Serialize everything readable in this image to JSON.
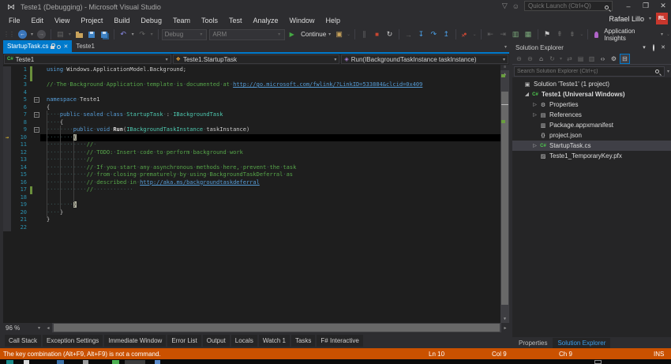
{
  "window": {
    "title": "Teste1 (Debugging) - Microsoft Visual Studio",
    "quick_launch_placeholder": "Quick Launch (Ctrl+Q)",
    "user_name": "Rafael Lillo",
    "avatar_initials": "RL"
  },
  "menu": {
    "items": [
      "File",
      "Edit",
      "View",
      "Project",
      "Build",
      "Debug",
      "Team",
      "Tools",
      "Test",
      "Analyze",
      "Window",
      "Help"
    ]
  },
  "toolbar": {
    "solution_config": "Debug",
    "solution_platform": "ARM",
    "continue_label": "Continue",
    "app_insights_label": "Application Insights"
  },
  "document_tabs": [
    {
      "label": "StartupTask.cs",
      "active": true,
      "locked": true,
      "pinned": false,
      "closable": true
    },
    {
      "label": "Teste1",
      "active": false
    }
  ],
  "navbar": {
    "project": "Teste1",
    "type": "Teste1.StartupTask",
    "member": "Run(IBackgroundTaskInstance taskInstance)"
  },
  "editor": {
    "zoom_level": "96 %",
    "lines": [
      {
        "t": [
          [
            "k",
            "using"
          ],
          [
            "p",
            " Windows.ApplicationModel.Background;"
          ]
        ],
        "chg": true
      },
      {
        "t": [],
        "chg": true
      },
      {
        "t": [
          [
            "c",
            "// The Background Application template is documented at "
          ],
          [
            "l",
            "http://go.microsoft.com/fwlink/?LinkID=533884&clcid=0x409"
          ]
        ]
      },
      {
        "t": []
      },
      {
        "t": [
          [
            "k",
            "namespace"
          ],
          [
            "p",
            " Teste1"
          ]
        ],
        "fold": true
      },
      {
        "t": [
          [
            "p",
            "{"
          ]
        ]
      },
      {
        "t": [
          [
            "p",
            "    "
          ],
          [
            "k",
            "public"
          ],
          [
            "p",
            " "
          ],
          [
            "k",
            "sealed"
          ],
          [
            "p",
            " "
          ],
          [
            "k",
            "class"
          ],
          [
            "p",
            " "
          ],
          [
            "t2",
            "StartupTask"
          ],
          [
            "p",
            " : "
          ],
          [
            "t2",
            "IBackgroundTask"
          ]
        ],
        "fold": true
      },
      {
        "t": [
          [
            "p",
            "    {"
          ]
        ]
      },
      {
        "t": [
          [
            "p",
            "        "
          ],
          [
            "k",
            "public"
          ],
          [
            "p",
            " "
          ],
          [
            "k",
            "void"
          ],
          [
            "p",
            " "
          ],
          [
            "pb",
            "Run"
          ],
          [
            "p",
            "("
          ],
          [
            "t2",
            "IBackgroundTaskInstance"
          ],
          [
            "p",
            " taskInstance)"
          ]
        ],
        "fold": true
      },
      {
        "t": [
          [
            "p",
            "        "
          ],
          [
            "b",
            "{"
          ]
        ],
        "exec": true
      },
      {
        "t": [
          [
            "p",
            "            "
          ],
          [
            "c",
            "//"
          ],
          [
            "p",
            " "
          ]
        ]
      },
      {
        "t": [
          [
            "p",
            "            "
          ],
          [
            "c",
            "// TODO: Insert code to perform background work"
          ]
        ]
      },
      {
        "t": [
          [
            "p",
            "            "
          ],
          [
            "c",
            "//"
          ]
        ]
      },
      {
        "t": [
          [
            "p",
            "            "
          ],
          [
            "c",
            "// If you start any asynchronous methods here, prevent the task"
          ]
        ]
      },
      {
        "t": [
          [
            "p",
            "            "
          ],
          [
            "c",
            "// from closing prematurely by using BackgroundTaskDeferral as"
          ]
        ]
      },
      {
        "t": [
          [
            "p",
            "            "
          ],
          [
            "c",
            "// described in "
          ],
          [
            "l",
            "http://aka.ms/backgroundtaskdeferral"
          ]
        ]
      },
      {
        "t": [
          [
            "p",
            "            "
          ],
          [
            "c",
            "//"
          ],
          [
            "p",
            "            "
          ]
        ],
        "chg": true
      },
      {
        "t": []
      },
      {
        "t": [
          [
            "p",
            "        "
          ],
          [
            "b",
            "}"
          ]
        ]
      },
      {
        "t": [
          [
            "p",
            "    }"
          ]
        ]
      },
      {
        "t": [
          [
            "p",
            "}"
          ]
        ]
      },
      {
        "t": []
      }
    ]
  },
  "solution_explorer": {
    "title": "Solution Explorer",
    "search_placeholder": "Search Solution Explorer (Ctrl+ç)",
    "tree": [
      {
        "label": "Solution 'Teste1' (1 project)",
        "icon": "solution",
        "indent": 0
      },
      {
        "label": "Teste1 (Universal Windows)",
        "icon": "csproj",
        "indent": 1,
        "exp": "open",
        "bold": true
      },
      {
        "label": "Properties",
        "icon": "wrench",
        "indent": 2,
        "exp": "closed"
      },
      {
        "label": "References",
        "icon": "refs",
        "indent": 2,
        "exp": "closed"
      },
      {
        "label": "Package.appxmanifest",
        "icon": "manifest",
        "indent": 2
      },
      {
        "label": "project.json",
        "icon": "json",
        "indent": 2
      },
      {
        "label": "StartupTask.cs",
        "icon": "cs",
        "indent": 2,
        "exp": "closed",
        "selected": true
      },
      {
        "label": "Teste1_TemporaryKey.pfx",
        "icon": "pfx",
        "indent": 2
      }
    ]
  },
  "bottom_tabs": [
    "Call Stack",
    "Exception Settings",
    "Immediate Window",
    "Error List",
    "Output",
    "Locals",
    "Watch 1",
    "Tasks",
    "F# Interactive"
  ],
  "panel_tabs": [
    {
      "label": "Properties",
      "active": false
    },
    {
      "label": "Solution Explorer",
      "active": true
    }
  ],
  "status_bar": {
    "message": "The key combination (Alt+F9, Alt+F9) is not a command.",
    "line": "Ln 10",
    "column": "Col 9",
    "character": "Ch 9",
    "mode": "INS"
  }
}
